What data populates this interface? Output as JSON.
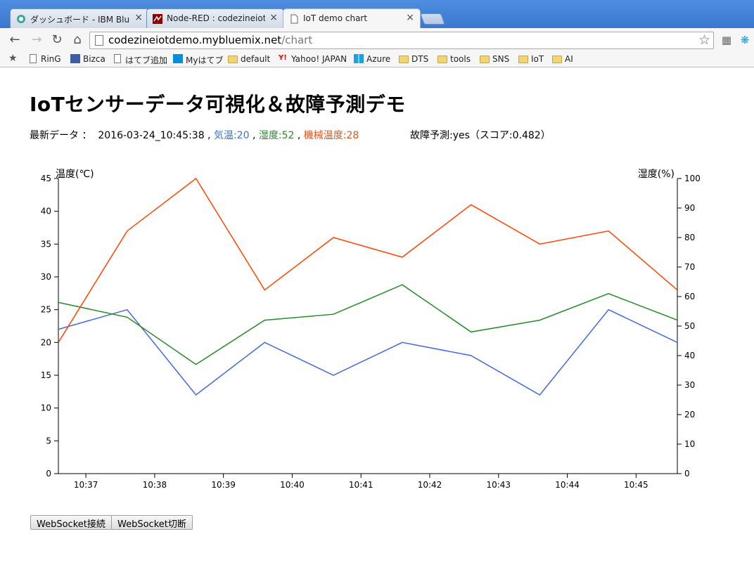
{
  "browser": {
    "tabs": [
      {
        "title": "ダッシュボード - IBM Bluemix",
        "icon": "bluemix-icon",
        "close": "×"
      },
      {
        "title": "Node-RED : codezineiotdemo",
        "icon": "node-red-icon",
        "close": "×"
      },
      {
        "title": "IoT demo chart",
        "icon": "page-icon",
        "close": "×"
      }
    ],
    "url_host": "codezineiotdemo.mybluemix.net",
    "url_path": "/chart",
    "bookmarks": [
      {
        "label": "RinG",
        "icon": "page-icon"
      },
      {
        "label": "Bizca",
        "icon": "bizca-icon"
      },
      {
        "label": "はてブ追加",
        "icon": "page-icon"
      },
      {
        "label": "Myはてブ",
        "icon": "hatena-icon"
      },
      {
        "label": "default",
        "icon": "folder-icon"
      },
      {
        "label": "Yahoo! JAPAN",
        "icon": "yahoo-icon"
      },
      {
        "label": "Azure",
        "icon": "windows-icon"
      },
      {
        "label": "DTS",
        "icon": "folder-icon"
      },
      {
        "label": "tools",
        "icon": "folder-icon"
      },
      {
        "label": "SNS",
        "icon": "folder-icon"
      },
      {
        "label": "IoT",
        "icon": "folder-icon"
      },
      {
        "label": "AI",
        "icon": "folder-icon"
      }
    ]
  },
  "page": {
    "title": "IoTセンサーデータ可視化＆故障予測デモ",
    "status": {
      "prefix": "最新データ ：  ",
      "timestamp": "2016-03-24_10:45:38",
      "sep1": " , ",
      "temp": "気温:20",
      "sep2": " , ",
      "humidity": "湿度:52",
      "sep3": " , ",
      "machine_temp": "機械温度:28"
    },
    "prediction": "故障予測:yes（スコア:0.482）",
    "buttons": {
      "connect": "WebSocket接続",
      "disconnect": "WebSocket切断"
    }
  },
  "chart_data": {
    "type": "line",
    "ylabel_left": "温度(℃)",
    "ylabel_right": "湿度(%)",
    "ylim_left": [
      0,
      45
    ],
    "ylim_right": [
      0,
      100
    ],
    "yticks_left": [
      0,
      5,
      10,
      15,
      20,
      25,
      30,
      35,
      40,
      45
    ],
    "yticks_right": [
      0,
      10,
      20,
      30,
      40,
      50,
      60,
      70,
      80,
      90,
      100
    ],
    "x_range_minutes": [
      36.6,
      45.6
    ],
    "xticks": [
      "10:37",
      "10:38",
      "10:39",
      "10:40",
      "10:41",
      "10:42",
      "10:43",
      "10:44",
      "10:45"
    ],
    "x": [
      36.6,
      37.6,
      38.6,
      39.6,
      40.6,
      41.6,
      42.6,
      43.6,
      44.6,
      45.6
    ],
    "series": [
      {
        "key": "temp",
        "axis": "left",
        "color": "#4169e1",
        "values": [
          22,
          25,
          12,
          20,
          15,
          20,
          18,
          12,
          25,
          20
        ]
      },
      {
        "key": "humidity",
        "axis": "right",
        "color": "#228b22",
        "values": [
          58,
          53,
          37,
          52,
          54,
          64,
          48,
          52,
          61,
          52
        ]
      },
      {
        "key": "machine_temp",
        "axis": "left",
        "color": "#ff4500",
        "values": [
          20,
          37,
          45,
          28,
          36,
          33,
          41,
          35,
          37,
          28
        ]
      }
    ],
    "grid": false
  }
}
